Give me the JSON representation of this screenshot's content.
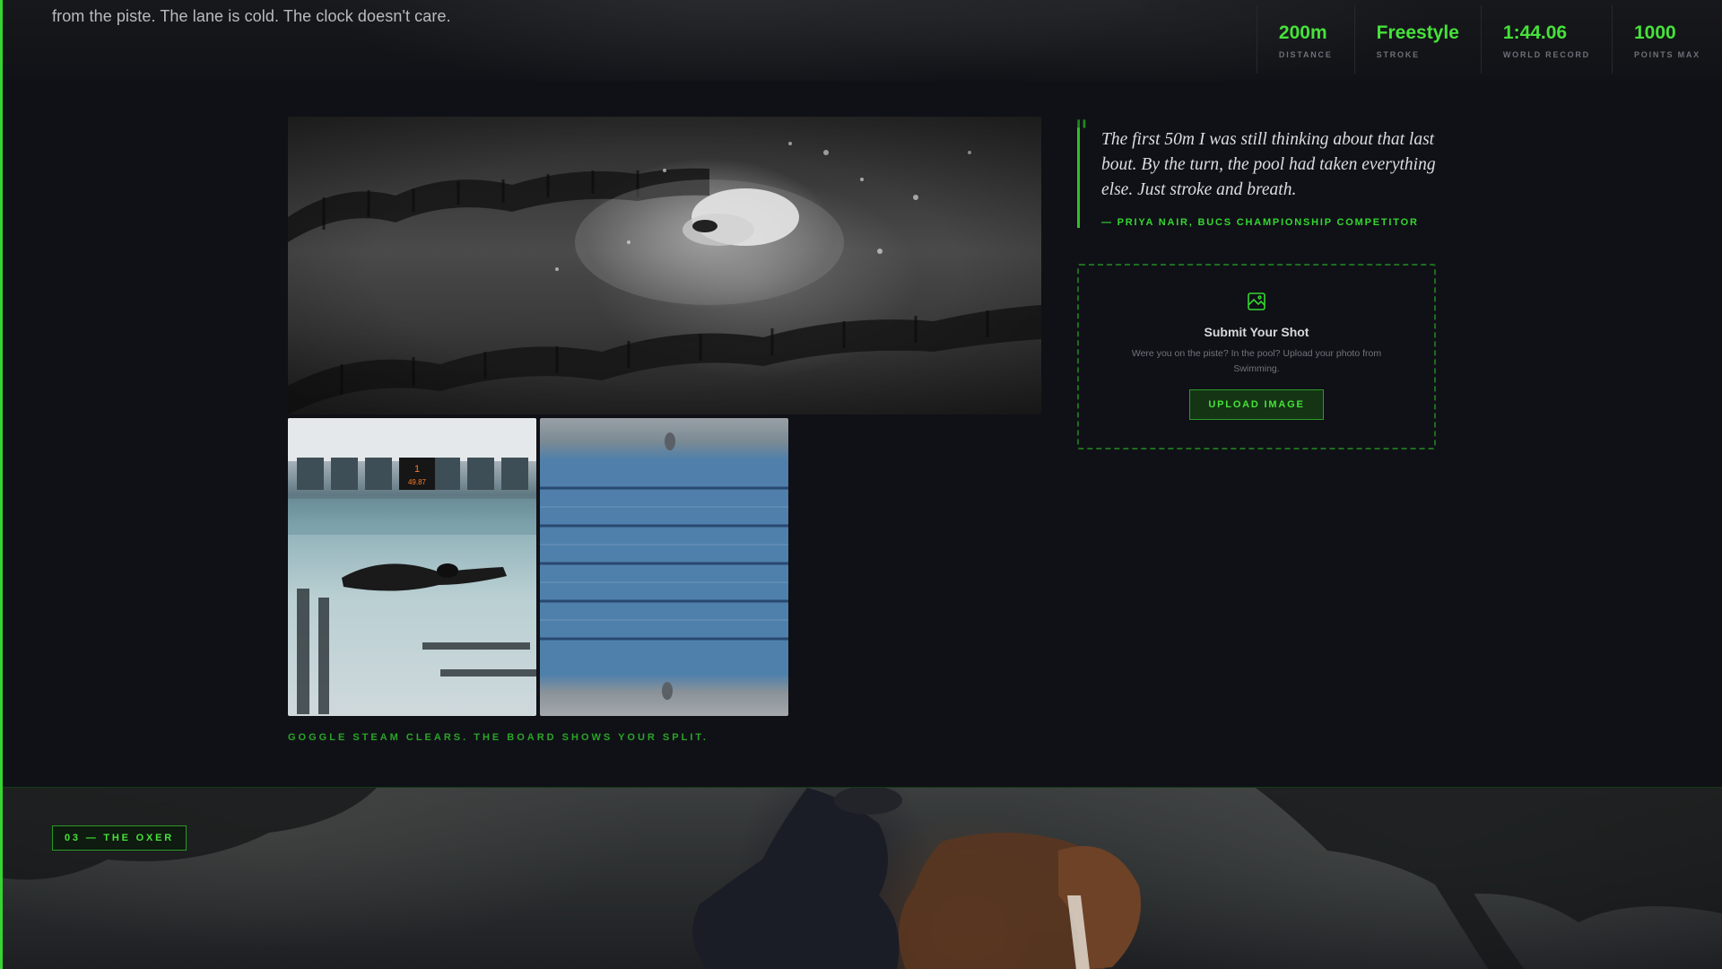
{
  "hero": {
    "intro": "from the piste. The lane is cold. The clock doesn't care.",
    "stats": [
      {
        "value": "200m",
        "label": "DISTANCE"
      },
      {
        "value": "Freestyle",
        "label": "STROKE"
      },
      {
        "value": "1:44.06",
        "label": "WORLD RECORD"
      },
      {
        "value": "1000",
        "label": "POINTS MAX"
      }
    ]
  },
  "gallery": {
    "caption": "GOGGLE STEAM CLEARS. THE BOARD SHOWS YOUR SPLIT.",
    "scoreboard": {
      "lane": "1",
      "time": "49.87"
    }
  },
  "quote": {
    "mark": "\"",
    "text": "The first 50m I was still thinking about that last bout. By the turn, the pool had taken everything else. Just stroke and breath.",
    "attribution": "— PRIYA NAIR, BUCS CHAMPIONSHIP COMPETITOR"
  },
  "upload": {
    "icon": "image-icon",
    "title": "Submit Your Shot",
    "description": "Were you on the piste? In the pool? Upload your photo from Swimming.",
    "button_label": "UPLOAD IMAGE"
  },
  "next_section": {
    "tag": "03 — THE OXER"
  },
  "colors": {
    "accent": "#46e23a",
    "background": "#101117",
    "border_accent": "#2a9a26"
  }
}
